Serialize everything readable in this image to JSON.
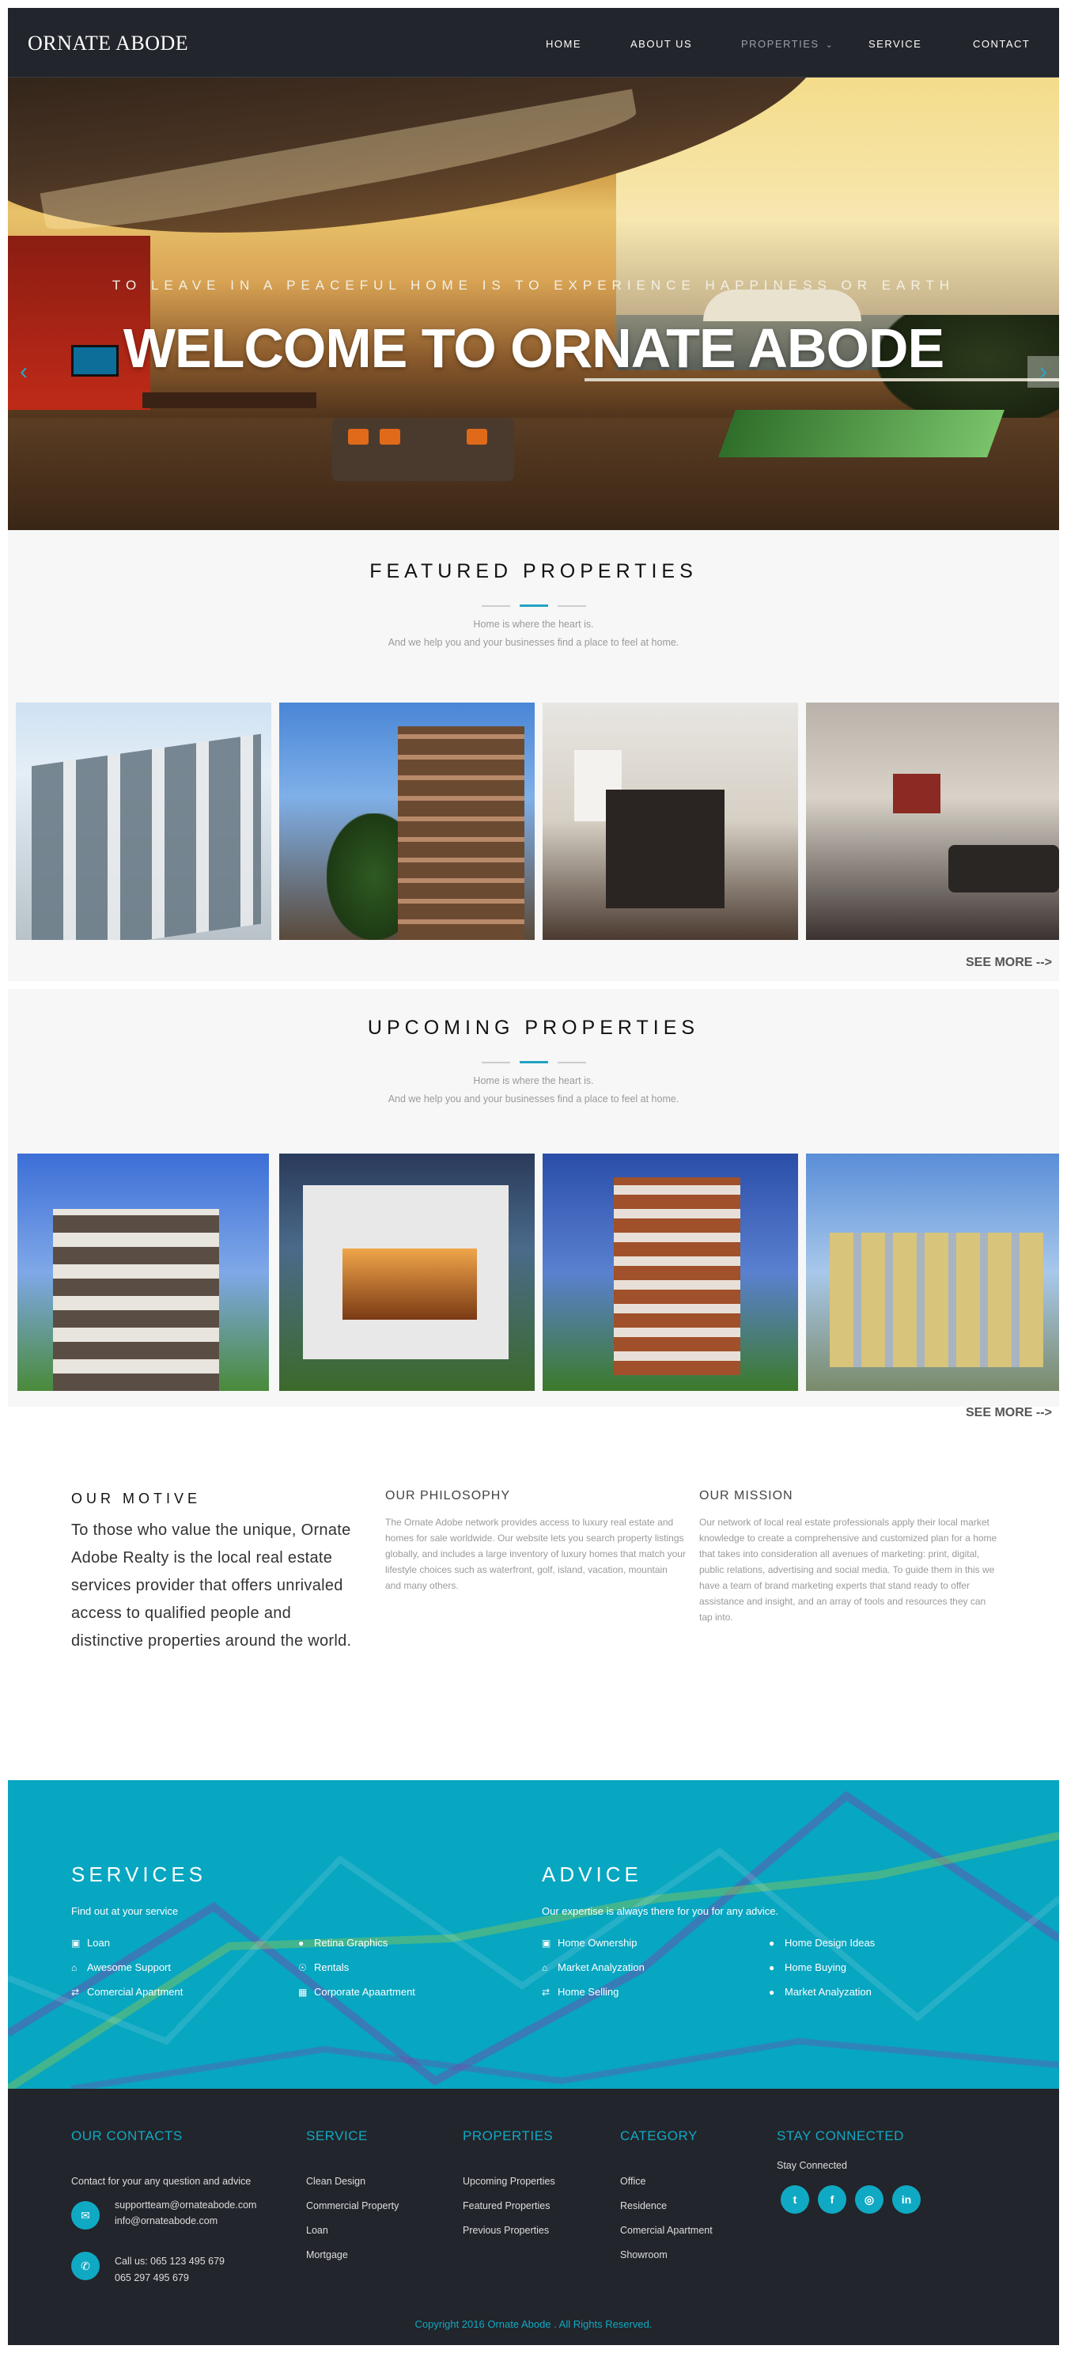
{
  "header": {
    "logo": "ORNATE ABODE",
    "nav": [
      "HOME",
      "ABOUT US",
      "PROPERTIES",
      "SERVICE",
      "CONTACT"
    ],
    "active_nav": "PROPERTIES",
    "dropdown_icon": "chevron-down-icon"
  },
  "hero": {
    "subtitle": "TO LEAVE IN A PEACEFUL HOME IS TO EXPERIENCE HAPPINESS OR EARTH",
    "title": "WELCOME TO ORNATE ABODE",
    "prev_icon": "chevron-left-icon",
    "next_icon": "chevron-right-icon",
    "slides": 4,
    "active_slide": 1
  },
  "featured": {
    "title": "FEATURED PROPERTIES",
    "line1": "Home is where the heart is.",
    "line2": "And we help you and your businesses find a place to feel at home.",
    "see_more": "SEE MORE -->"
  },
  "upcoming": {
    "title": "UPCOMING PROPERTIES",
    "line1": "Home is where the heart is.",
    "line2": "And we help you and your businesses find a place to feel at home.",
    "see_more": "SEE MORE -->"
  },
  "motive": {
    "heading": "OUR MOTIVE",
    "text": "To those who value the unique, Ornate Adobe Realty is the local real estate services provider that offers unrivaled access to qualified people and distinctive properties around the world.",
    "philosophy_title": "OUR PHILOSOPHY",
    "philosophy_text": "The Ornate Adobe network provides access to luxury real estate and homes for sale worldwide. Our website lets you search property listings globally, and includes a large inventory of luxury homes that match your lifestyle choices such as waterfront, golf, island, vacation, mountain and many others.",
    "mission_title": "OUR MISSION",
    "mission_text": "Our network of local real estate professionals apply their local market knowledge to create a comprehensive and customized plan for a home that takes into consideration all avenues of marketing: print, digital, public relations, advertising and social media. To guide them in this we have a team of brand marketing experts that stand ready to offer assistance and insight, and an array of tools and resources they can tap into."
  },
  "services": {
    "title": "SERVICES",
    "subtitle": "Find out at your service",
    "col1": [
      {
        "icon": "money-icon",
        "label": "Loan"
      },
      {
        "icon": "home-icon",
        "label": "Awesome Support"
      },
      {
        "icon": "exchange-icon",
        "label": "Comercial Apartment"
      }
    ],
    "col2": [
      {
        "icon": "users-icon",
        "label": "Retina Graphics"
      },
      {
        "icon": "globe-icon",
        "label": "Rentals"
      },
      {
        "icon": "building-icon",
        "label": "Corporate Apaartment"
      }
    ]
  },
  "advice": {
    "title": "ADVICE",
    "subtitle": "Our expertise is always there for you for any advice.",
    "col1": [
      {
        "icon": "money-icon",
        "label": "Home Ownership"
      },
      {
        "icon": "home-icon",
        "label": "Market Analyzation"
      },
      {
        "icon": "exchange-icon",
        "label": "Home Selling"
      }
    ],
    "col2": [
      {
        "icon": "users-icon",
        "label": "Home Design Ideas"
      },
      {
        "icon": "users-icon",
        "label": "Home Buying"
      },
      {
        "icon": "users-icon",
        "label": "Market Analyzation"
      }
    ]
  },
  "footer": {
    "contacts_title": "OUR CONTACTS",
    "contacts_intro": "Contact for your any question and advice",
    "email1": "supportteam@ornateabode.com",
    "email2": "info@ornateabode.com",
    "phone_label": "Call us: 065 123 495 679",
    "phone2": "065 297 495 679",
    "email_icon": "envelope-icon",
    "phone_icon": "phone-icon",
    "service_title": "SERVICE",
    "service_links": [
      "Clean Design",
      "Commercial Property",
      "Loan",
      "Mortgage"
    ],
    "properties_title": "PROPERTIES",
    "properties_links": [
      "Upcoming Properties",
      "Featured Properties",
      "Previous Properties"
    ],
    "category_title": "CATEGORY",
    "category_links": [
      "Office",
      "Residence",
      "Comercial Apartment",
      "Showroom"
    ],
    "stay_title": "STAY CONNECTED",
    "stay_text": "Stay Connected",
    "social": [
      {
        "icon": "twitter-icon",
        "glyph": "t"
      },
      {
        "icon": "facebook-icon",
        "glyph": "f"
      },
      {
        "icon": "rss-icon",
        "glyph": "◎"
      },
      {
        "icon": "linkedin-icon",
        "glyph": "in"
      }
    ],
    "copyright": "Copyright 2016 Ornate Abode . All Rights Reserved."
  },
  "colors": {
    "accent": "#10a9c4",
    "services_bg": "#07a6c1",
    "dark_bg": "#22252b"
  }
}
